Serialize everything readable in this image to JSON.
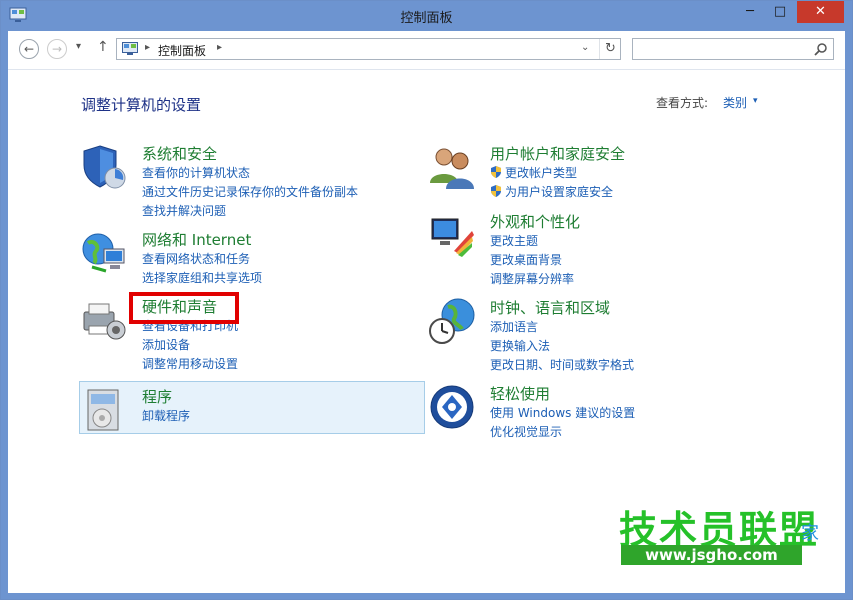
{
  "window": {
    "title": "控制面板",
    "buttons": {
      "minimize": "─",
      "maximize": "□",
      "close": "✕"
    }
  },
  "addressbar": {
    "back_icon": "arrow-left-icon",
    "forward_icon": "arrow-right-icon",
    "recent_icon": "chevron-down-icon",
    "up_icon": "arrow-up-icon",
    "back_label": "←",
    "forward_label": "→",
    "recent_label": "▾",
    "up_label": "↑",
    "path": "控制面板",
    "path_sep": "▸",
    "dropdown_label": "⌄",
    "refresh_label": "↻",
    "search_placeholder": ""
  },
  "main": {
    "heading": "调整计算机的设置",
    "view_by_label": "查看方式:",
    "view_by_value": "类别",
    "view_by_arrow": "▾",
    "categories": [
      {
        "title": "系统和安全",
        "links": [
          "查看你的计算机状态",
          "通过文件历史记录保存你的文件备份副本",
          "查找并解决问题"
        ]
      },
      {
        "title": "网络和 Internet",
        "links": [
          "查看网络状态和任务",
          "选择家庭组和共享选项"
        ]
      },
      {
        "title": "硬件和声音",
        "links": [
          "查看设备和打印机",
          "添加设备",
          "调整常用移动设置"
        ]
      },
      {
        "title": "程序",
        "links": [
          "卸载程序"
        ]
      },
      {
        "title": "用户帐户和家庭安全",
        "links": [
          "更改帐户类型",
          "为用户设置家庭安全"
        ]
      },
      {
        "title": "外观和个性化",
        "links": [
          "更改主题",
          "更改桌面背景",
          "调整屏幕分辨率"
        ]
      },
      {
        "title": "时钟、语言和区域",
        "links": [
          "添加语言",
          "更换输入法",
          "更改日期、时间或数字格式"
        ]
      },
      {
        "title": "轻松使用",
        "links": [
          "使用 Windows 建议的设置",
          "优化视觉显示"
        ]
      }
    ]
  },
  "watermark": {
    "main": "技术员联盟",
    "tail": "家",
    "url": "www.jsgho.com"
  },
  "colors": {
    "title_bar": "#6d94d0",
    "category_title": "#1e7d32",
    "link": "#1d5fb5",
    "heading": "#1e3287",
    "highlight": "#e10000"
  }
}
